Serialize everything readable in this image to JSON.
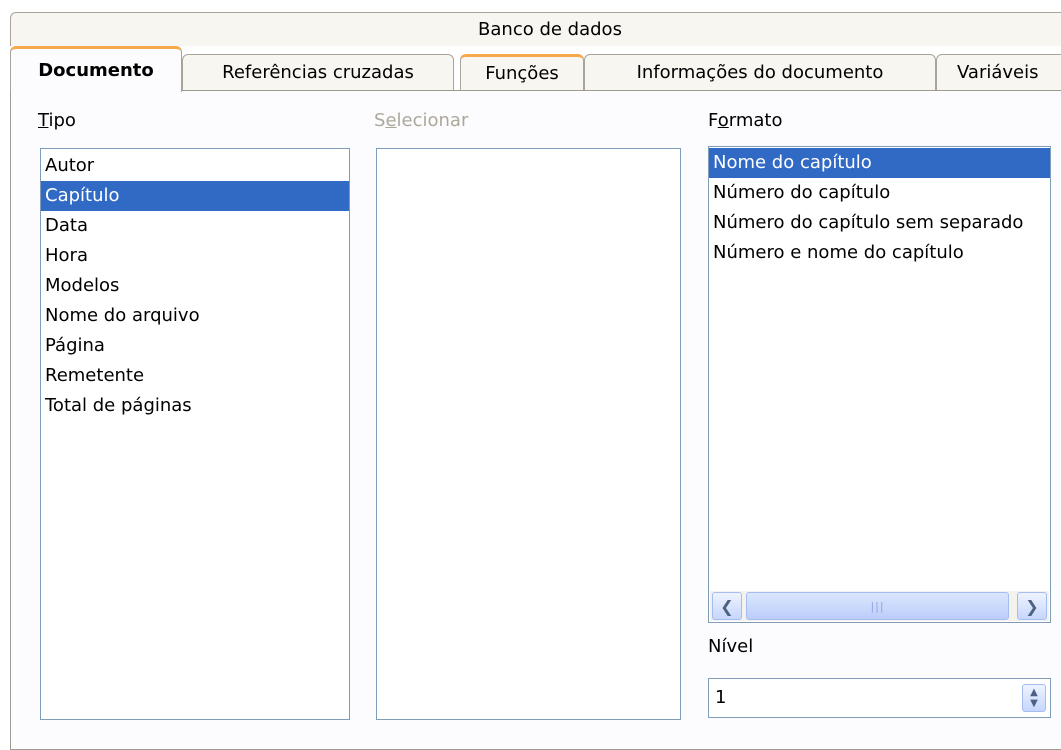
{
  "tabs": {
    "row1": [
      "Banco de dados"
    ],
    "row2": [
      "Documento",
      "Referências cruzadas",
      "Funções",
      "Informações do documento",
      "Variáveis"
    ]
  },
  "tipo": {
    "label_first": "T",
    "label_rest": "ipo",
    "items": [
      "Autor",
      "Capítulo",
      "Data",
      "Hora",
      "Modelos",
      "Nome do arquivo",
      "Página",
      "Remetente",
      "Total de páginas"
    ],
    "selected": "Capítulo"
  },
  "selecionar": {
    "label_first": "S",
    "label_underline": "e",
    "label_rest": "lecionar"
  },
  "formato": {
    "label_first": "F",
    "label_underline": "o",
    "label_rest": "rmato",
    "items": [
      "Nome do capítulo",
      "Número do capítulo",
      "Número do capítulo sem separado",
      "Número e nome do capítulo"
    ],
    "selected": "Nome do capítulo"
  },
  "nivel": {
    "label": "Nível",
    "value": "1"
  },
  "icons": {
    "scroll_left": "chevron-left-icon",
    "scroll_right": "chevron-right-icon",
    "grip": "scroll-grip-icon",
    "spin": "spin-updown-icon"
  },
  "colors": {
    "selection": "#316ac5",
    "active_tab_accent": "#f4a94a",
    "border": "#7f9db9"
  }
}
